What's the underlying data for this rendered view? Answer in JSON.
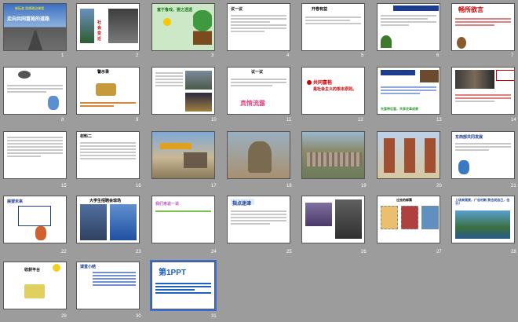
{
  "slides": [
    {
      "n": "1",
      "title": "走向共同富裕的道路",
      "subtitle": "新标准 思想政治课程"
    },
    {
      "n": "2",
      "title": "社会变迁"
    },
    {
      "n": "3",
      "title": "富于鲁戏，要之透透"
    },
    {
      "n": "4",
      "title": "议一议"
    },
    {
      "n": "5",
      "title": "开卷有益"
    },
    {
      "n": "6",
      "title": "走向共同富裕的道路"
    },
    {
      "n": "7",
      "title": "畅所欲言"
    },
    {
      "n": "8",
      "title": ""
    },
    {
      "n": "9",
      "title": "警示录"
    },
    {
      "n": "10",
      "title": ""
    },
    {
      "n": "11",
      "title": "议一议",
      "extra": "真情流露"
    },
    {
      "n": "12",
      "title": "共同富裕",
      "extra": "是社会主义的根本原则。"
    },
    {
      "n": "13",
      "title": "走向共同富裕的道路",
      "extra": "先富带后富，共享改革成果"
    },
    {
      "n": "14",
      "title": ""
    },
    {
      "n": "15",
      "title": ""
    },
    {
      "n": "16",
      "title": "材料二"
    },
    {
      "n": "17",
      "title": ""
    },
    {
      "n": "18",
      "title": ""
    },
    {
      "n": "19",
      "title": ""
    },
    {
      "n": "20",
      "title": ""
    },
    {
      "n": "21",
      "title": "东西部共同发展"
    },
    {
      "n": "22",
      "title": "展望未来"
    },
    {
      "n": "23",
      "title": "大学生招聘会现场"
    },
    {
      "n": "24",
      "title": "我们来说一说"
    },
    {
      "n": "25",
      "title": "指点迷津"
    },
    {
      "n": "26",
      "title": ""
    },
    {
      "n": "27",
      "title": "过去的邮票"
    },
    {
      "n": "28",
      "title": "上场来观赏，广谷村新 我也说自己，也不？"
    },
    {
      "n": "29",
      "title": "收获平台"
    },
    {
      "n": "30",
      "title": "课堂小结"
    },
    {
      "n": "31",
      "title": "第1PPT"
    }
  ],
  "colors": {
    "background": "#9c9c9c",
    "selection": "#3a6fd8"
  }
}
